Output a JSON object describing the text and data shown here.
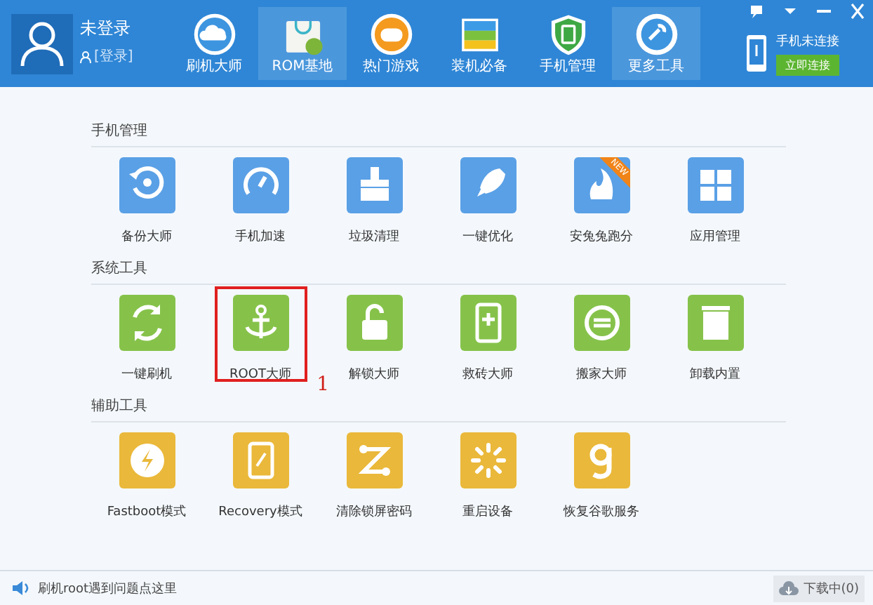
{
  "user": {
    "name": "未登录",
    "login_link": "[登录]"
  },
  "nav": [
    {
      "label": "刷机大师",
      "selected": false
    },
    {
      "label": "ROM基地",
      "selected": true
    },
    {
      "label": "热门游戏",
      "selected": false
    },
    {
      "label": "装机必备",
      "selected": false
    },
    {
      "label": "手机管理",
      "selected": false
    },
    {
      "label": "更多工具",
      "selected": true
    }
  ],
  "device": {
    "status": "手机未连接",
    "button": "立即连接"
  },
  "sections": [
    {
      "title": "手机管理",
      "color": "#5aa0e6",
      "items": [
        {
          "label": "备份大师",
          "highlighted": false
        },
        {
          "label": "手机加速",
          "highlighted": false
        },
        {
          "label": "垃圾清理",
          "highlighted": false
        },
        {
          "label": "一键优化",
          "highlighted": false
        },
        {
          "label": "安兔兔跑分",
          "highlighted": false,
          "badge": "NEW"
        },
        {
          "label": "应用管理",
          "highlighted": false
        }
      ]
    },
    {
      "title": "系统工具",
      "color": "#86c24a",
      "items": [
        {
          "label": "一键刷机",
          "highlighted": false
        },
        {
          "label": "ROOT大师",
          "highlighted": true,
          "annotation": "1"
        },
        {
          "label": "解锁大师",
          "highlighted": false
        },
        {
          "label": "救砖大师",
          "highlighted": false
        },
        {
          "label": "搬家大师",
          "highlighted": false
        },
        {
          "label": "卸载内置",
          "highlighted": false
        }
      ]
    },
    {
      "title": "辅助工具",
      "color": "#eab83a",
      "items": [
        {
          "label": "Fastboot模式",
          "highlighted": false
        },
        {
          "label": "Recovery模式",
          "highlighted": false
        },
        {
          "label": "清除锁屏密码",
          "highlighted": false
        },
        {
          "label": "重启设备",
          "highlighted": false
        },
        {
          "label": "恢复谷歌服务",
          "highlighted": false
        }
      ]
    }
  ],
  "status_bar": {
    "message": "刷机root遇到问题点这里",
    "downloads": "下载中(0)"
  }
}
